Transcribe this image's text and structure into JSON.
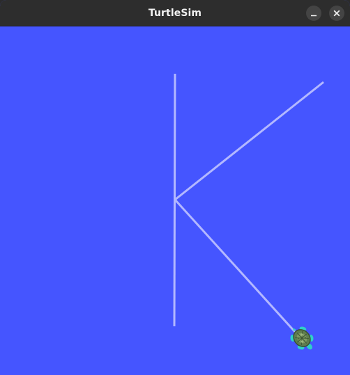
{
  "window": {
    "title": "TurtleSim",
    "buttons": {
      "minimize_icon": "minimize-icon",
      "close_icon": "close-icon"
    }
  },
  "canvas": {
    "background_color": "#4555ff",
    "pen_color": "#b3b8ff",
    "turtle_icon": "turtle-icon"
  }
}
